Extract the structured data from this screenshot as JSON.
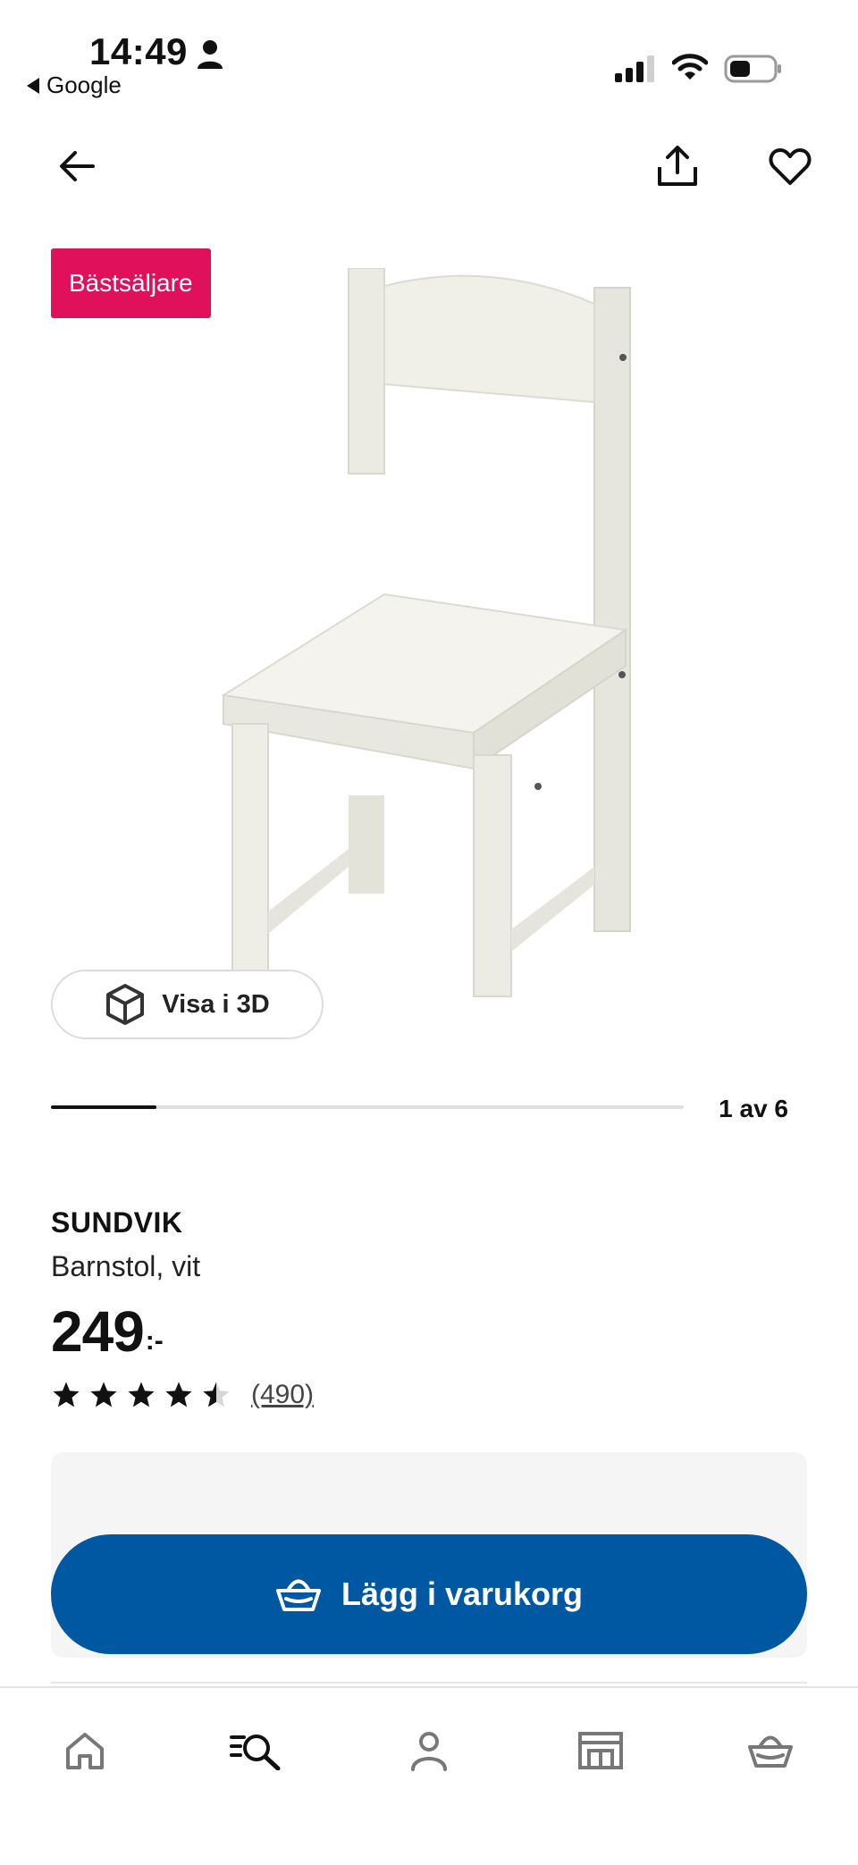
{
  "status_bar": {
    "time": "14:49",
    "back_app": "Google"
  },
  "top_nav": {
    "back_icon": "arrow-left-icon",
    "share_icon": "share-icon",
    "favorite_icon": "heart-icon"
  },
  "hero": {
    "badge": "Bästsäljare",
    "view_3d_label": "Visa i 3D",
    "image_counter": "1 av 6",
    "progress_fraction": 0.1667
  },
  "product": {
    "name": "SUNDVIK",
    "description": "Barnstol, vit",
    "price": "249",
    "price_suffix": ":-",
    "rating": 4.5,
    "review_count": "(490)"
  },
  "cart": {
    "add_label": "Lägg i varukorg"
  },
  "tab_bar": {
    "items": [
      "home-icon",
      "search-icon",
      "profile-icon",
      "store-icon",
      "basket-icon"
    ]
  },
  "colors": {
    "badge": "#e0105a",
    "primary_button": "#0058a3"
  }
}
